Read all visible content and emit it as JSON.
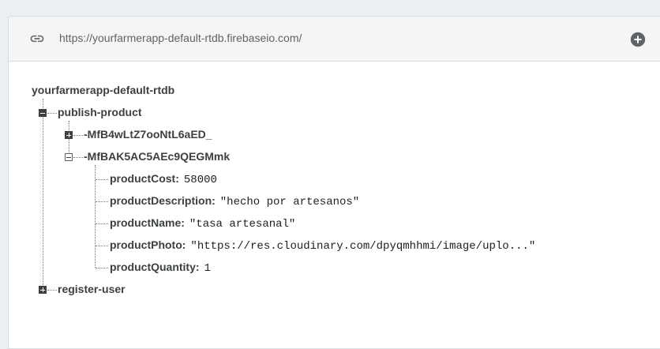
{
  "url_bar": {
    "url": "https://yourfarmerapp-default-rtdb.firebaseio.com/",
    "link_icon": "link-icon",
    "add_icon": "add-circle-icon"
  },
  "tree": {
    "root": "yourfarmerapp-default-rtdb",
    "publish_product": {
      "key": "publish-product",
      "expanded": true,
      "children": [
        {
          "key": "-MfB4wLtZ7ooNtL6aED_",
          "expanded": false
        },
        {
          "key": "-MfBAK5AC5AEc9QEGMmk",
          "expanded": true,
          "fields": [
            {
              "key": "productCost:",
              "value": "58000"
            },
            {
              "key": "productDescription:",
              "value": "\"hecho por artesanos\""
            },
            {
              "key": "productName:",
              "value": "\"tasa artesanal\""
            },
            {
              "key": "productPhoto:",
              "value": "\"https://res.cloudinary.com/dpyqmhhmi/image/uplo...\""
            },
            {
              "key": "productQuantity:",
              "value": "1"
            }
          ]
        }
      ]
    },
    "register_user": {
      "key": "register-user",
      "expanded": false
    }
  },
  "colors": {
    "page_bg": "#eceff1",
    "url_bar_bg": "#f5f5f5",
    "key_text": "#3c4043",
    "value_text": "#202124",
    "icon": "#5f6368"
  }
}
